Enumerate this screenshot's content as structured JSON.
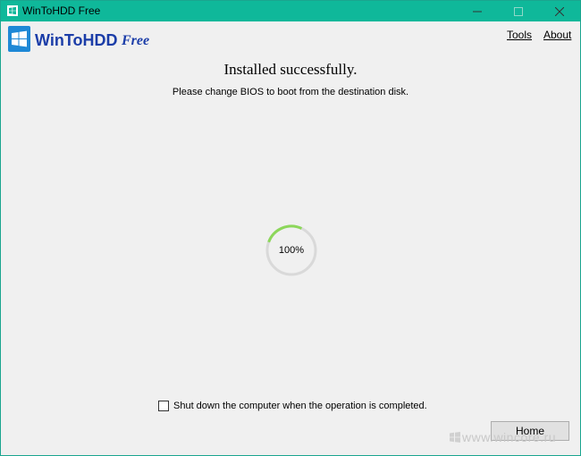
{
  "window": {
    "title": "WinToHDD Free",
    "controls": {
      "minimize": "minimize",
      "maximize": "maximize",
      "close": "close"
    }
  },
  "header": {
    "brand": "WinToHDD",
    "brand_suffix": "Free",
    "menu": [
      "Tools",
      "About"
    ]
  },
  "status": {
    "headline": "Installed successfully.",
    "message": "Please change BIOS to boot from the destination disk."
  },
  "progress": {
    "label": "100%",
    "value": 100
  },
  "options": {
    "shutdown_label": "Shut down the computer when the operation is completed.",
    "shutdown_checked": false
  },
  "footer": {
    "home_label": "Home"
  },
  "watermark": {
    "text": "www.wincore.ru"
  },
  "colors": {
    "titlebar": "#0fb89a",
    "brand": "#1b3da8",
    "progress_track": "#d9d9d9",
    "progress_arc": "#8cd75a"
  }
}
